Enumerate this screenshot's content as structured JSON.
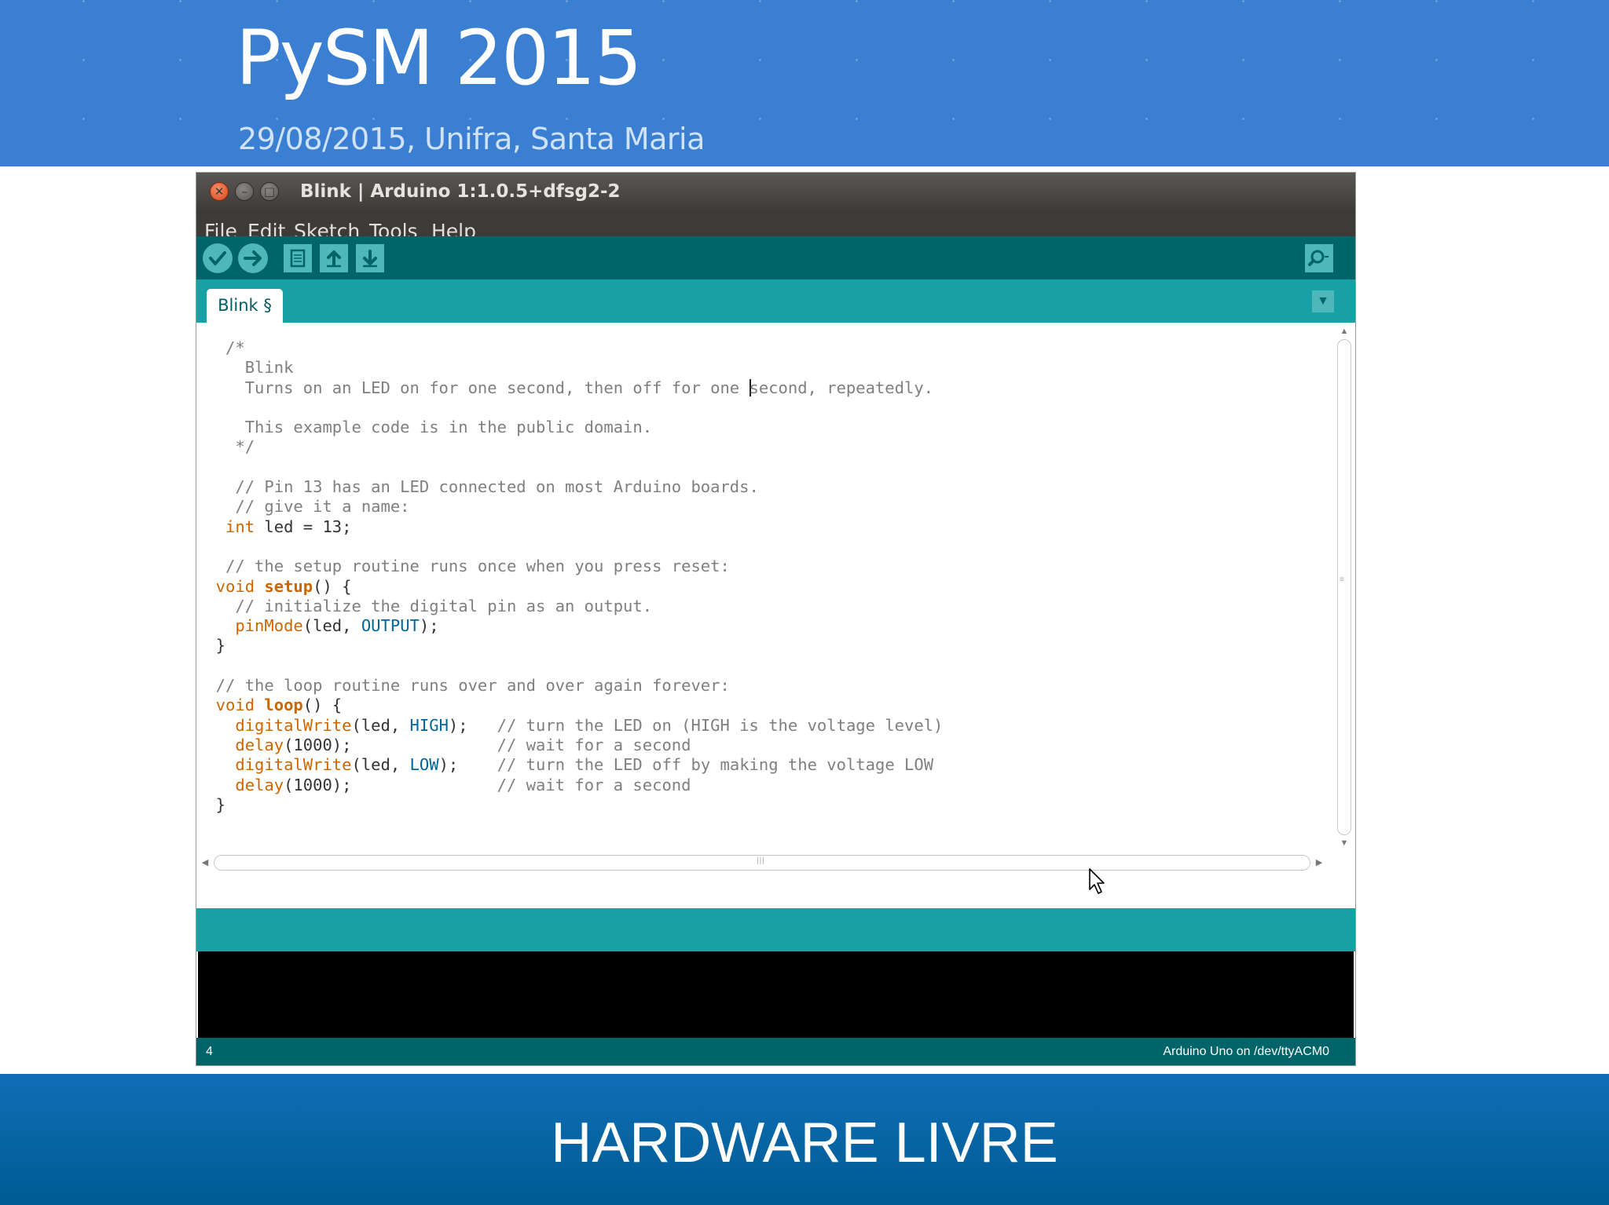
{
  "banner": {
    "title": "PySM 2015",
    "subtitle": "29/08/2015, Unifra, Santa Maria"
  },
  "window": {
    "title": "Blink | Arduino 1:1.0.5+dfsg2-2",
    "menu": [
      "File",
      "Edit",
      "Sketch",
      "Tools",
      "Help"
    ],
    "toolbar": {
      "buttons": [
        {
          "name": "verify",
          "icon": "check-icon"
        },
        {
          "name": "upload",
          "icon": "arrow-right-icon"
        },
        {
          "name": "new",
          "icon": "document-icon"
        },
        {
          "name": "open",
          "icon": "arrow-up-icon"
        },
        {
          "name": "save",
          "icon": "arrow-down-icon"
        }
      ],
      "serial_monitor_icon": "magnifier-icon"
    },
    "tab": {
      "label": "Blink §"
    },
    "status": {
      "line_number": "4",
      "board": "Arduino Uno on /dev/ttyACM0"
    },
    "colors": {
      "teal_dark": "#006468",
      "teal": "#17a1a5",
      "button": "#4db7bb",
      "keyword": "#cc6600",
      "constant": "#006699",
      "comment": "#7f7f7f"
    }
  },
  "code": {
    "l1": "   /*",
    "l2": "     Blink",
    "l3a": "     Turns on an LED on for one second, then off for one ",
    "l3b": "second, repeatedly.",
    "l4": "",
    "l5": "     This example code is in the public domain.",
    "l6": "    */",
    "l7": "",
    "l8": "    // Pin 13 has an LED connected on most Arduino boards.",
    "l9": "    // give it a name:",
    "l10_kw": "   int",
    "l10_rest": " led = 13;",
    "l11": "",
    "l12": "   // the setup routine runs once when you press reset:",
    "l13_kw": "  void",
    "l13_fn": "setup",
    "l13_rest": "() {",
    "l14": "    // initialize the digital pin as an output.",
    "l15_fn": "    pinMode",
    "l15_a": "(led, ",
    "l15_const": "OUTPUT",
    "l15_b": ");",
    "l16": "  }",
    "l17": "",
    "l18": "  // the loop routine runs over and over again forever:",
    "l19_kw": "  void",
    "l19_fn": "loop",
    "l19_rest": "() {",
    "l20_fn": "    digitalWrite",
    "l20_a": "(led, ",
    "l20_const": "HIGH",
    "l20_b": ");   ",
    "l20_cmt": "// turn the LED on (HIGH is the voltage level)",
    "l21_fn": "    delay",
    "l21_a": "(1000);               ",
    "l21_cmt": "// wait for a second",
    "l22_fn": "    digitalWrite",
    "l22_a": "(led, ",
    "l22_const": "LOW",
    "l22_b": ");    ",
    "l22_cmt": "// turn the LED off by making the voltage LOW",
    "l23_fn": "    delay",
    "l23_a": "(1000);               ",
    "l23_cmt": "// wait for a second",
    "l24": "  }"
  },
  "footer": {
    "title": "HARDWARE LIVRE"
  }
}
